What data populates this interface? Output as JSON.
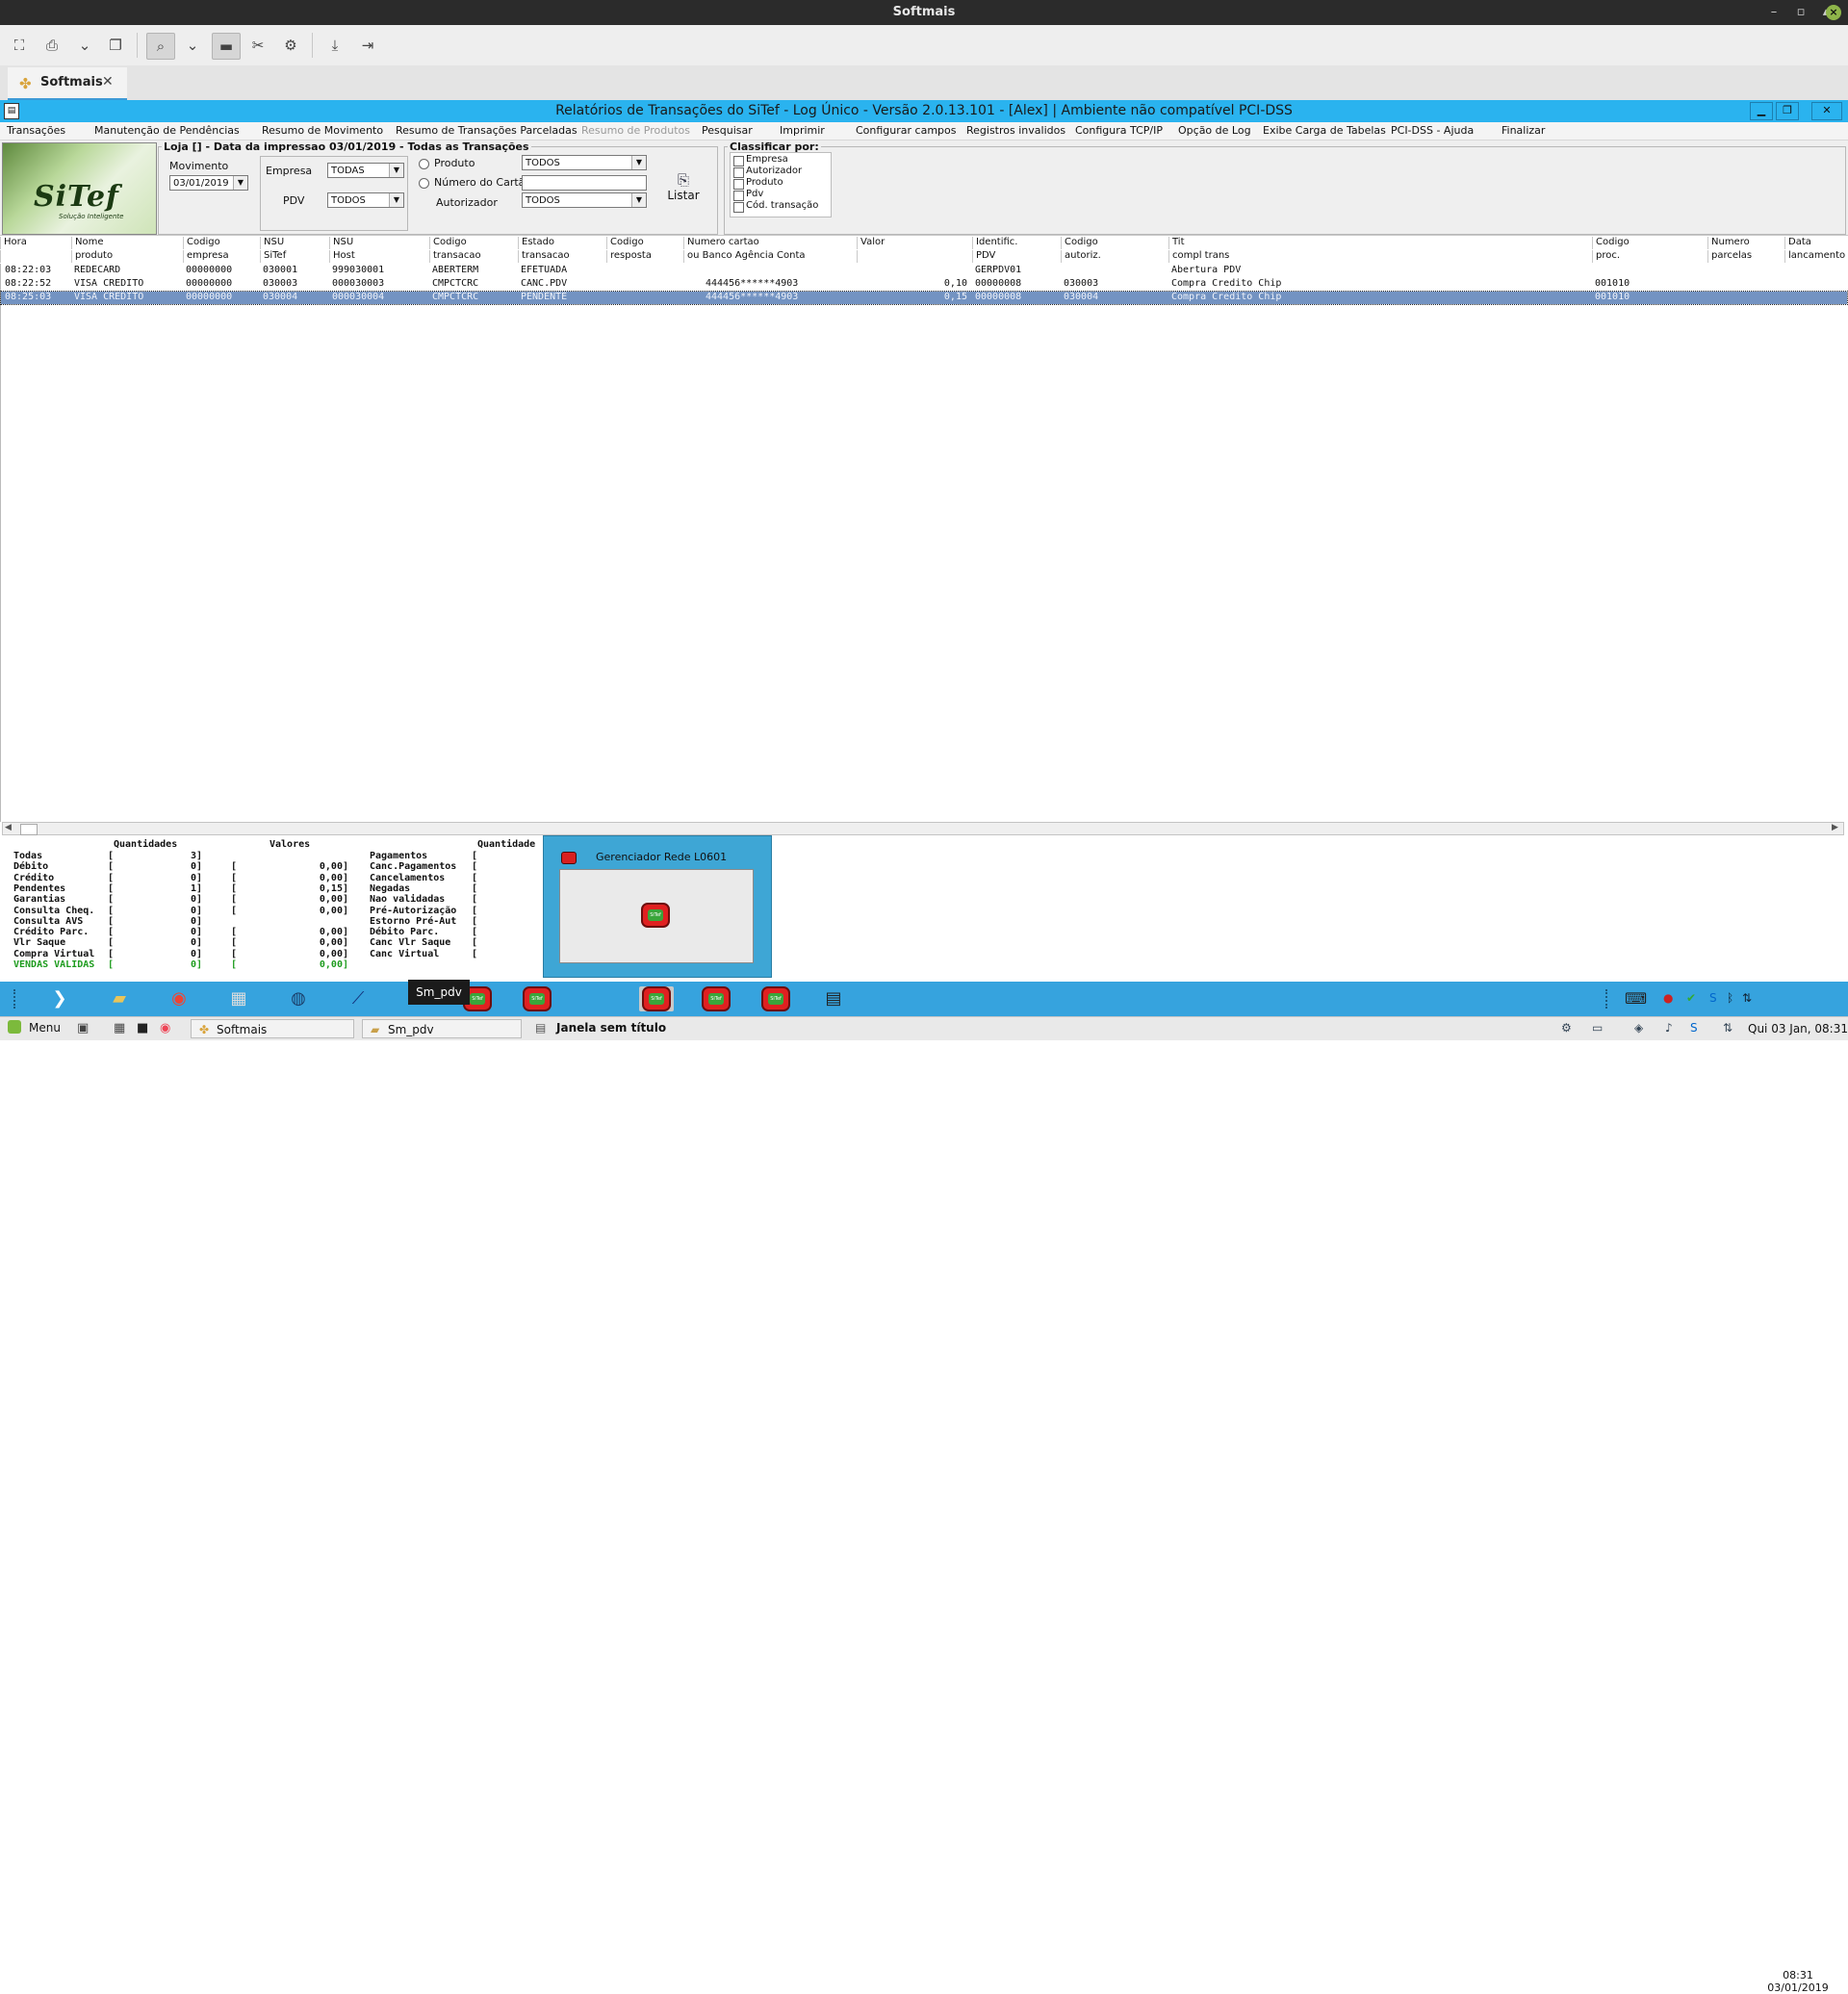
{
  "os": {
    "title": "Softmais"
  },
  "tab": {
    "label": "Softmais"
  },
  "app": {
    "title": "Relatórios de Transações do SiTef - Log Único - Versão 2.0.13.101  -  [Alex] | Ambiente não compatível PCI-DSS",
    "menu": [
      "Transações",
      "Manutenção de Pendências",
      "Resumo de Movimento",
      "Resumo de Transações Parceladas",
      "Resumo de Produtos",
      "Pesquisar",
      "Imprimir",
      "Configurar campos",
      "Registros invalidos",
      "Configura TCP/IP",
      "Opção de Log",
      "Exibe Carga de Tabelas",
      "PCI-DSS - Ajuda",
      "Finalizar"
    ]
  },
  "logo": {
    "text": "SiTef",
    "sub": "Solução Inteligente"
  },
  "filter": {
    "group_title": "Loja [] - Data da impressao 03/01/2019 - Todas as Transações",
    "movimento_label": "Movimento",
    "movimento_value": "03/01/2019",
    "empresa_label": "Empresa",
    "empresa_value": "TODAS",
    "pdv_label": "PDV",
    "pdv_value": "TODOS",
    "produto_label": "Produto",
    "produto_value": "TODOS",
    "cartao_label": "Número do Cartão",
    "cartao_value": "",
    "autorizador_label": "Autorizador",
    "autorizador_value": "TODOS",
    "listar_label": "Listar"
  },
  "classify": {
    "title": "Classificar por:",
    "options": [
      "Empresa",
      "Autorizador",
      "Produto",
      "Pdv",
      "Cód. transação"
    ]
  },
  "grid": {
    "headers_top": [
      "Hora",
      "Nome",
      "Codigo",
      "NSU",
      "NSU",
      "Codigo",
      "Estado",
      "Codigo",
      "Numero  cartao",
      "Valor",
      "Identific.",
      "Codigo",
      "Tit",
      "Codigo",
      "Numero",
      "Data"
    ],
    "headers_bottom": [
      "",
      "produto",
      "empresa",
      "SiTef",
      "Host",
      "transacao",
      "transacao",
      "resposta",
      "ou Banco Agência Conta",
      "",
      "PDV",
      "autoriz.",
      "compl trans",
      "proc.",
      "parcelas",
      "lancamento"
    ],
    "rows": [
      {
        "hora": "08:22:03",
        "nome": "REDECARD",
        "empresa": "00000000",
        "nsu_sitef": "030001",
        "nsu_host": "999030001",
        "cod_trans": "ABERTERM",
        "estado": "EFETUADA",
        "cartao": "",
        "valor": "",
        "pdv": "GERPDV01",
        "autoriz": "",
        "compl": "Abertura PDV",
        "proc": ""
      },
      {
        "hora": "08:22:52",
        "nome": "VISA CREDITO",
        "empresa": "00000000",
        "nsu_sitef": "030003",
        "nsu_host": "000030003",
        "cod_trans": "CMPCTCRC",
        "estado": "CANC.PDV",
        "cartao": "444456******4903",
        "valor": "0,10",
        "pdv": "00000008",
        "autoriz": "030003",
        "compl": "Compra Credito Chip",
        "proc": "001010"
      },
      {
        "hora": "08:25:03",
        "nome": "VISA CREDITO",
        "empresa": "00000000",
        "nsu_sitef": "030004",
        "nsu_host": "000030004",
        "cod_trans": "CMPCTCRC",
        "estado": "PENDENTE",
        "cartao": "444456******4903",
        "valor": "0,15",
        "pdv": "00000008",
        "autoriz": "030004",
        "compl": "Compra Credito Chip",
        "proc": "001010"
      }
    ]
  },
  "summary": {
    "col1_header": "Quantidades",
    "col2_header": "Valores",
    "col3_header": "Quantidade",
    "left_rows": [
      {
        "label": "Todas",
        "qty": "3]",
        "val": ""
      },
      {
        "label": "Débito",
        "qty": "0]",
        "val": "0,00]"
      },
      {
        "label": "Crédito",
        "qty": "0]",
        "val": "0,00]"
      },
      {
        "label": "Pendentes",
        "qty": "1]",
        "val": "0,15]"
      },
      {
        "label": "Garantias",
        "qty": "0]",
        "val": "0,00]"
      },
      {
        "label": "Consulta Cheq.",
        "qty": "0]",
        "val": "0,00]"
      },
      {
        "label": "Consulta AVS",
        "qty": "0]",
        "val": ""
      },
      {
        "label": "Crédito Parc.",
        "qty": "0]",
        "val": "0,00]"
      },
      {
        "label": "Vlr Saque",
        "qty": "0]",
        "val": "0,00]"
      },
      {
        "label": "Compra Virtual",
        "qty": "0]",
        "val": "0,00]"
      },
      {
        "label": "VENDAS VALIDAS",
        "qty": "0]",
        "val": "0,00]"
      }
    ],
    "right_rows": [
      "Pagamentos",
      "Canc.Pagamentos",
      "Cancelamentos",
      "Negadas",
      "Nao validadas",
      "Pré-Autorização",
      "Estorno Pré-Aut",
      "Débito Parc.",
      "Canc Vlr Saque",
      "Canc Virtual"
    ],
    "green_color": "#1e9c1e"
  },
  "popup": {
    "title": "Gerenciador Rede L0601"
  },
  "taskbar": {
    "tooltip": "Sm_pdv",
    "clock_time": "08:31",
    "clock_date": "03/01/2019",
    "menu_label": "Menu",
    "tasks": [
      "Softmais",
      "Sm_pdv",
      "Janela sem título"
    ],
    "bottom_clock": "Qui 03 Jan, 08:31",
    "accent": "#36a3de"
  }
}
